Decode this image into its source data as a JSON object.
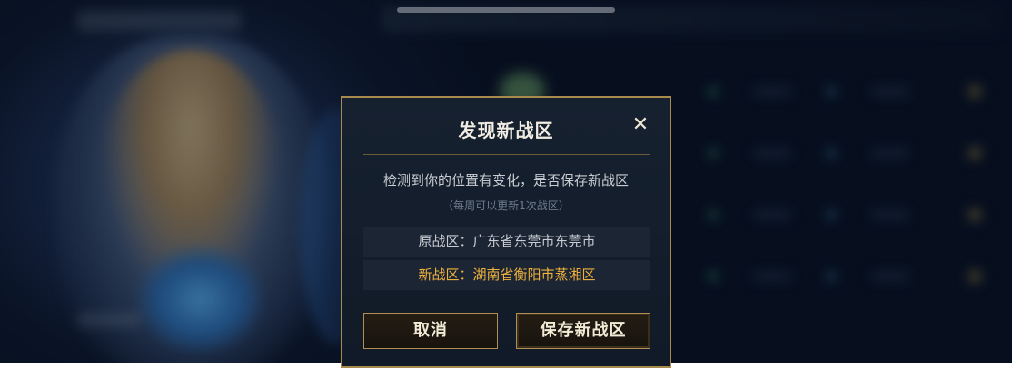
{
  "dialog": {
    "title": "发现新战区",
    "close_icon": "close-icon",
    "message": "检测到你的位置有变化，是否保存新战区",
    "note": "（每周可以更新1次战区）",
    "old_region": {
      "label": "原战区：",
      "value": "广东省东莞市东莞市"
    },
    "new_region": {
      "label": "新战区：",
      "value": "湖南省衡阳市蒸湘区"
    },
    "cancel_label": "取消",
    "save_label": "保存新战区"
  },
  "colors": {
    "accent_gold": "#b18f52",
    "new_region_text": "#f0b23c",
    "dialog_bg": "#131d2b"
  }
}
